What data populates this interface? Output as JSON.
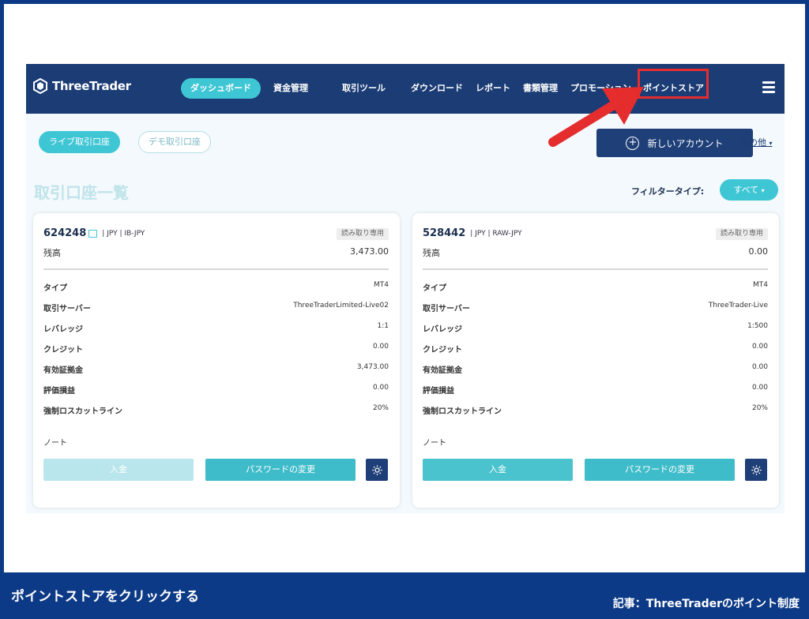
{
  "navbar": {
    "logo_text": "ThreeTrader",
    "items": [
      {
        "label": "ダッシュボード",
        "active": true
      },
      {
        "label": "資金管理"
      },
      {
        "label": "取引ツール"
      },
      {
        "label": "ダウンロード"
      },
      {
        "label": "レポート"
      },
      {
        "label": "書類管理"
      },
      {
        "label": "プロモーション"
      },
      {
        "label": "ポイントストア"
      }
    ]
  },
  "tabs": {
    "live": "ライブ取引口座",
    "demo": "デモ取引口座"
  },
  "new_account_label": "新しいアカウント",
  "other_label": "その他",
  "section_title": "取引口座一覧",
  "filter": {
    "label": "フィルタータイプ:",
    "value": "すべて"
  },
  "accounts": [
    {
      "number": "624248",
      "currency": "JPY",
      "group": "IB-JPY",
      "badge": "読み取り専用",
      "balance_label": "残高",
      "balance": "3,473.00",
      "rows": [
        {
          "k": "タイプ",
          "v": "MT4"
        },
        {
          "k": "取引サーバー",
          "v": "ThreeTraderLimited-Live02"
        },
        {
          "k": "レバレッジ",
          "v": "1:1"
        },
        {
          "k": "クレジット",
          "v": "0.00"
        },
        {
          "k": "有効証拠金",
          "v": "3,473.00"
        },
        {
          "k": "評価損益",
          "v": "0.00"
        },
        {
          "k": "強制ロスカットライン",
          "v": "20%"
        }
      ],
      "note": "ノート",
      "deposit": "入金",
      "password": "パスワードの変更"
    },
    {
      "number": "528442",
      "currency": "JPY",
      "group": "RAW-JPY",
      "badge": "読み取り専用",
      "balance_label": "残高",
      "balance": "0.00",
      "rows": [
        {
          "k": "タイプ",
          "v": "MT4"
        },
        {
          "k": "取引サーバー",
          "v": "ThreeTrader-Live"
        },
        {
          "k": "レバレッジ",
          "v": "1:500"
        },
        {
          "k": "クレジット",
          "v": "0.00"
        },
        {
          "k": "有効証拠金",
          "v": "0.00"
        },
        {
          "k": "評価損益",
          "v": "0.00"
        },
        {
          "k": "強制ロスカットライン",
          "v": "20%"
        }
      ],
      "note": "ノート",
      "deposit": "入金",
      "password": "パスワードの変更"
    }
  ],
  "caption": {
    "left": "ポイントストアをクリックする",
    "right": "記事：ThreeTraderのポイント制度"
  },
  "colors": {
    "navy": "#1b3c74",
    "teal": "#3fc6d4",
    "highlight": "#e52d2d",
    "frame": "#0d3a86"
  }
}
